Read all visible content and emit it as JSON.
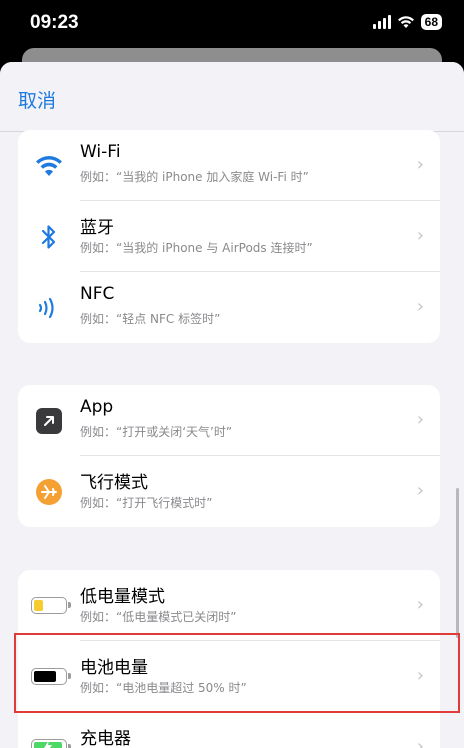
{
  "status_bar": {
    "time": "09:23",
    "battery": "68"
  },
  "nav": {
    "cancel_label": "取消"
  },
  "groups": [
    {
      "rows": [
        {
          "title": "Wi-Fi",
          "subtitle": "例如：“当我的 iPhone 加入家庭 Wi-Fi 时”",
          "icon": "wifi-icon"
        },
        {
          "title": "蓝牙",
          "subtitle": "例如：“当我的 iPhone 与 AirPods 连接时”",
          "icon": "bluetooth-icon"
        },
        {
          "title": "NFC",
          "subtitle": "例如：“轻点 NFC 标签时”",
          "icon": "nfc-icon"
        }
      ]
    },
    {
      "rows": [
        {
          "title": "App",
          "subtitle": "例如：“打开或关闭‘天气’时”",
          "icon": "app-icon"
        },
        {
          "title": "飞行模式",
          "subtitle": "例如：“打开飞行模式时”",
          "icon": "airplane-icon"
        }
      ]
    },
    {
      "rows": [
        {
          "title": "低电量模式",
          "subtitle": "例如：“低电量模式已关闭时”",
          "icon": "low-battery-icon"
        },
        {
          "title": "电池电量",
          "subtitle": "例如：“电池电量超过 50% 时”",
          "icon": "battery-icon"
        },
        {
          "title": "充电器",
          "subtitle": "",
          "icon": "charger-icon"
        }
      ]
    }
  ],
  "colors": {
    "accent": "#1f7ae0",
    "airplane": "#f4a033",
    "low_battery": "#f5cd2e",
    "charging": "#4cd964",
    "highlight": "#e03a3a"
  }
}
